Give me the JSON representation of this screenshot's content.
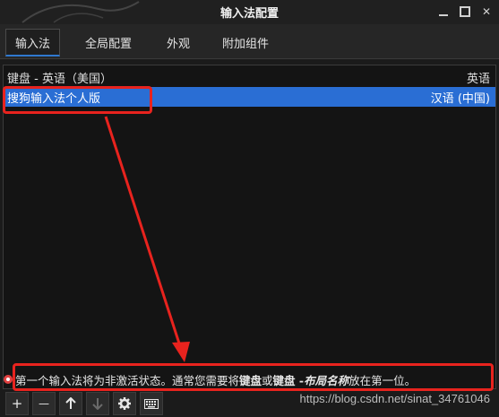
{
  "window": {
    "title": "输入法配置"
  },
  "tabs": [
    {
      "label": "输入法",
      "active": true
    },
    {
      "label": "全局配置"
    },
    {
      "label": "外观"
    },
    {
      "label": "附加组件"
    }
  ],
  "list": {
    "header": {
      "name": "键盘 - 英语（美国）",
      "lang": "英语"
    },
    "selected": {
      "name": "搜狗输入法个人版",
      "lang": "汉语 (中国)"
    }
  },
  "hint": {
    "part1": "第一个输入法将为非激活状态。通常您需要将",
    "bold1": "键盘",
    "part2": "或",
    "bold2": "键盘 - ",
    "italic": "布局名称",
    "part3": "放在第一位。"
  },
  "toolbar": {
    "add": "+",
    "remove": "—"
  },
  "watermark": "https://blog.csdn.net/sinat_34761046",
  "colors": {
    "selection": "#2a6ed4",
    "annotation": "#e8231e"
  }
}
